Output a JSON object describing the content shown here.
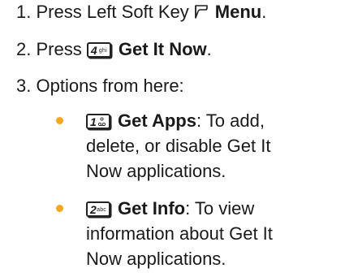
{
  "steps": [
    {
      "number": "1.",
      "pre": "Press Left Soft Key",
      "label": "Menu",
      "post": "."
    },
    {
      "number": "2.",
      "pre": "Press",
      "key_digit": "4",
      "key_letters": "ghi",
      "label": "Get It Now",
      "post": "."
    },
    {
      "number": "3.",
      "text": "Options from here:"
    }
  ],
  "options": [
    {
      "key_digit": "1",
      "key_letters": "",
      "label": "Get Apps",
      "desc_lines": [
        ": To add,",
        "delete, or disable Get It",
        "Now applications."
      ]
    },
    {
      "key_digit": "2",
      "key_letters": "abc",
      "label": "Get Info",
      "desc_lines": [
        ": To view",
        "information about Get It",
        "Now applications."
      ]
    }
  ],
  "colors": {
    "bullet": "#f5a623",
    "text": "#1a1a1a"
  },
  "icons": {
    "soft_key": "left-soft-key-icon",
    "voicemail": "voicemail-icon"
  }
}
